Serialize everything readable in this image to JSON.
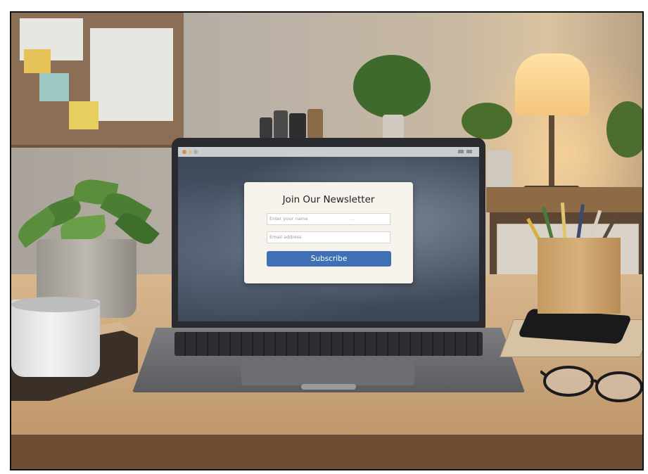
{
  "scene": {
    "description_objects": [
      "laptop",
      "potted-plant",
      "coffee-mug",
      "notebooks",
      "pencil-holder",
      "smartphone",
      "eyeglasses",
      "desk-lamp"
    ]
  },
  "newsletter": {
    "title": "Join Our Newsletter",
    "field1_placeholder": "Enter your name",
    "field1_hint": "...",
    "field2_placeholder": "Email address",
    "subscribe_label": "Subscribe"
  },
  "colors": {
    "subscribe_button": "#3f6fb4",
    "modal_background": "#f6f2ec",
    "desk_wood": "#caa67c",
    "lamp_glow": "#ffe2a8"
  }
}
